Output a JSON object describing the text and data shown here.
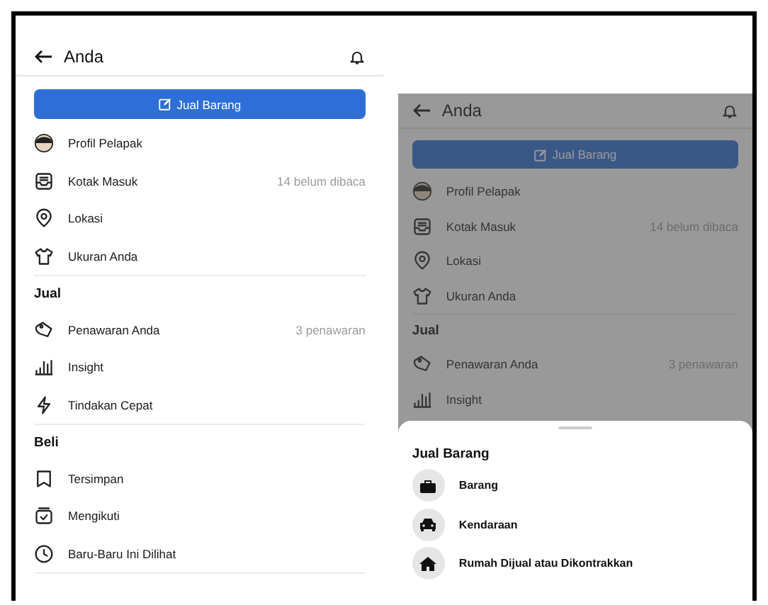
{
  "screens": [
    {
      "title": "Anda",
      "dimmed": false,
      "sell_button": "Jual Barang",
      "sections": [
        {
          "items": [
            {
              "label": "Profil Pelapak"
            },
            {
              "label": "Kotak Masuk",
              "detail": "14 belum dibaca"
            },
            {
              "label": "Lokasi"
            },
            {
              "label": "Ukuran Anda"
            }
          ]
        },
        {
          "heading": "Jual",
          "items": [
            {
              "label": "Penawaran Anda",
              "detail": "3 penawaran"
            },
            {
              "label": "Insight"
            },
            {
              "label": "Tindakan Cepat"
            }
          ]
        },
        {
          "heading": "Beli",
          "items": [
            {
              "label": "Tersimpan"
            },
            {
              "label": "Mengikuti"
            },
            {
              "label": "Baru-Baru Ini Dilihat"
            }
          ]
        }
      ]
    },
    {
      "title": "Anda",
      "dimmed": true,
      "sell_button": "Jual Barang",
      "sections": [
        {
          "items": [
            {
              "label": "Profil Pelapak"
            },
            {
              "label": "Kotak Masuk",
              "detail": "14 belum dibaca"
            },
            {
              "label": "Lokasi"
            },
            {
              "label": "Ukuran Anda"
            }
          ]
        },
        {
          "heading": "Jual",
          "items": [
            {
              "label": "Penawaran Anda",
              "detail": "3 penawaran"
            },
            {
              "label": "Insight"
            }
          ]
        }
      ],
      "sheet": {
        "title": "Jual Barang",
        "options": [
          {
            "label": "Barang"
          },
          {
            "label": "Kendaraan"
          },
          {
            "label": "Rumah Dijual atau Dikontrakkan"
          }
        ]
      }
    }
  ]
}
